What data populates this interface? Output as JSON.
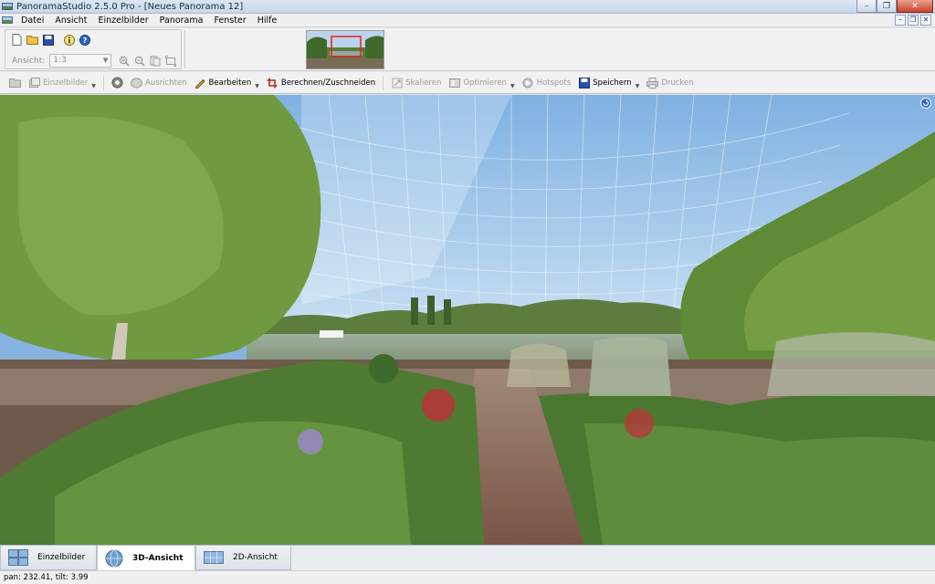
{
  "window": {
    "title": "PanoramaStudio 2.5.0 Pro - [Neues Panorama 12]",
    "buttons": {
      "minimize": "–",
      "maximize": "❐",
      "close": "✕"
    }
  },
  "menubar": {
    "items": [
      "Datei",
      "Ansicht",
      "Einzelbilder",
      "Panorama",
      "Fenster",
      "Hilfe"
    ],
    "mdi_buttons": {
      "minimize": "–",
      "restore": "❐",
      "close": "✕"
    }
  },
  "toolbar": {
    "zoom_label": "Ansicht:",
    "zoom_value": "1:3"
  },
  "toolbar2": {
    "einzelbilder": "Einzelbilder",
    "ausrichten": "Ausrichten",
    "bearbeiten": "Bearbeiten",
    "berechnen": "Berechnen/Zuschneiden",
    "skalieren": "Skalieren",
    "optimieren": "Optimieren",
    "hotspots": "Hotspots",
    "speichern": "Speichern",
    "drucken": "Drucken"
  },
  "tabs": {
    "einzelbilder": "Einzelbilder",
    "ansicht_3d": "3D-Ansicht",
    "ansicht_2d": "2D-Ansicht"
  },
  "status": {
    "text": "pan: 232.41, tilt: 3.99"
  },
  "colors": {
    "sky": "#86b3df",
    "foliage": "#5f8a3a",
    "path": "#8a6a58",
    "water": "#8f9d86",
    "save_accent": "#1a3d9a"
  }
}
